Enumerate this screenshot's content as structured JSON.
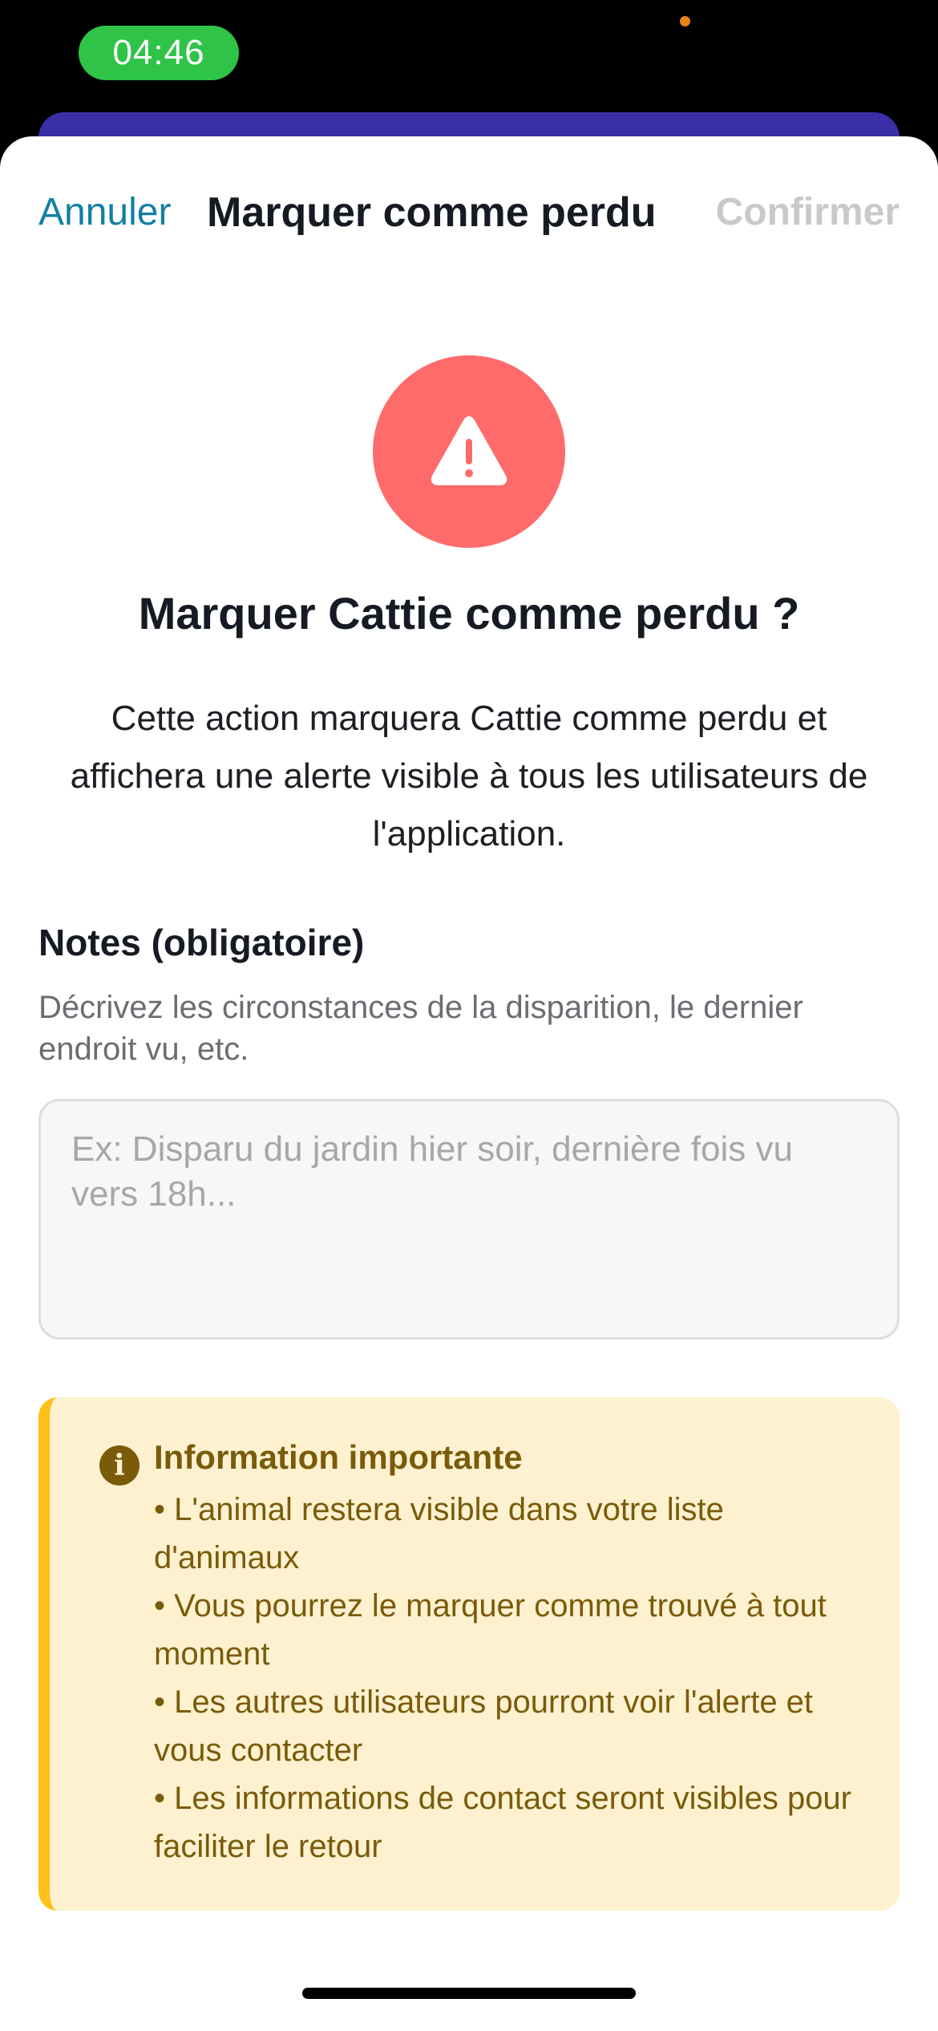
{
  "status_bar": {
    "time": "04:46"
  },
  "nav": {
    "cancel_label": "Annuler",
    "title": "Marquer comme perdu",
    "confirm_label": "Confirmer"
  },
  "warning": {
    "icon": "warning-triangle-icon",
    "headline": "Marquer Cattie comme perdu ?",
    "description": "Cette action marquera Cattie comme perdu et affichera une alerte visible à tous les utilisateurs de l'application."
  },
  "notes": {
    "label": "Notes (obligatoire)",
    "help": "Décrivez les circonstances de la disparition, le dernier endroit vu, etc.",
    "placeholder": "Ex: Disparu du jardin hier soir, dernière fois vu vers 18h...",
    "value": ""
  },
  "info": {
    "icon": "info-icon",
    "title": "Information importante",
    "items": [
      "• L'animal restera visible dans votre liste d'animaux",
      "• Vous pourrez le marquer comme trouvé à tout moment",
      "• Les autres utilisateurs pourront voir l'alerte et vous contacter",
      "• Les informations de contact seront visibles pour faciliter le retour"
    ]
  },
  "colors": {
    "accent_link": "#137fa5",
    "warning_circle": "#ff6b6b",
    "info_bg": "#fdf1cf",
    "info_border": "#fcc219",
    "info_text": "#7a5b0a",
    "confirm_disabled": "#c9c9cc",
    "status_green": "#2fc447",
    "underlay_purple": "#3b2fa8"
  }
}
